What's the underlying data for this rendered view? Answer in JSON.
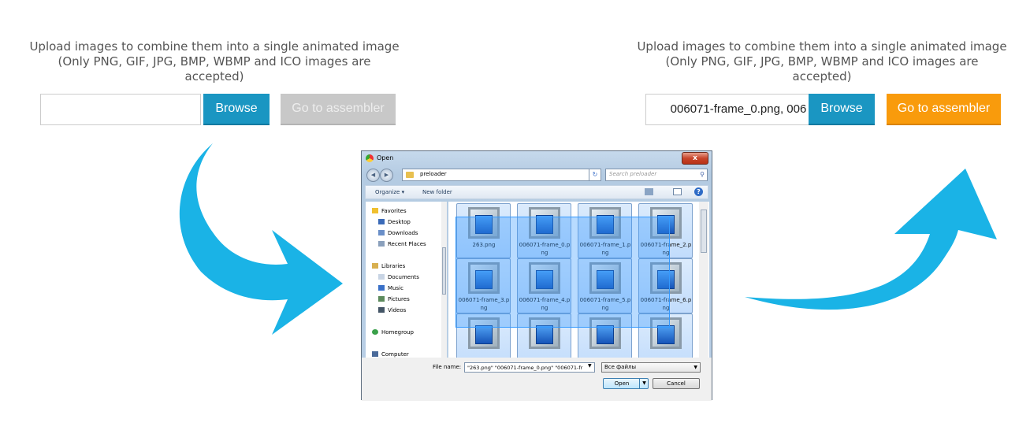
{
  "left_panel": {
    "intro_line1": "Upload images to combine them into a single animated image",
    "intro_line2": "(Only PNG, GIF, JPG, BMP, WBMP and ICO images are accepted)",
    "file_value": "",
    "browse_label": "Browse",
    "assembler_label": "Go to assembler"
  },
  "right_panel": {
    "intro_line1": "Upload images to combine them into a single animated image",
    "intro_line2": "(Only PNG, GIF, JPG, BMP, WBMP and ICO images are accepted)",
    "file_value": "006071-frame_0.png, 006",
    "browse_label": "Browse",
    "assembler_label": "Go to assembler"
  },
  "dialog": {
    "title": "Open",
    "close_glyph": "x",
    "path": "preloader",
    "search_placeholder": "Search preloader",
    "toolbar": {
      "organize": "Organize ▾",
      "new_folder": "New folder",
      "help": "?"
    },
    "nav": {
      "favorites": "Favorites",
      "desktop": "Desktop",
      "downloads": "Downloads",
      "recent": "Recent Places",
      "libraries": "Libraries",
      "documents": "Documents",
      "music": "Music",
      "pictures": "Pictures",
      "videos": "Videos",
      "homegroup": "Homegroup",
      "computer": "Computer"
    },
    "files": [
      {
        "name": "263.png"
      },
      {
        "name": "006071-frame_0.png"
      },
      {
        "name": "006071-frame_1.png"
      },
      {
        "name": "006071-frame_2.png"
      },
      {
        "name": "006071-frame_3.png"
      },
      {
        "name": "006071-frame_4.png"
      },
      {
        "name": "006071-frame_5.png"
      },
      {
        "name": "006071-frame_6.png"
      },
      {
        "name": ""
      },
      {
        "name": ""
      },
      {
        "name": ""
      },
      {
        "name": ""
      }
    ],
    "file_name_label": "File name:",
    "file_name_value": "\"263.png\" \"006071-frame_0.png\" \"006071-fr",
    "file_type": "Все файлы",
    "open_label": "Open",
    "cancel_label": "Cancel"
  },
  "colors": {
    "browse": "#1a96c2",
    "assembler_disabled": "#c8c8c8",
    "assembler_enabled": "#f99b0c",
    "arrow": "#1ab3e6"
  }
}
